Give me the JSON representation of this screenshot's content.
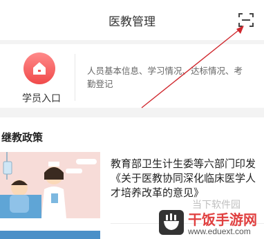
{
  "header": {
    "title": "医教管理",
    "scan_icon": "scan-icon"
  },
  "entry": {
    "label": "学员入口",
    "icon": "house-icon",
    "icon_color": "#f05252",
    "description": "人员基本信息、学习情况、达标情况、考勤登记"
  },
  "section": {
    "title": "继教政策"
  },
  "news": [
    {
      "title": "教育部卫生计生委等六部门印发《关于医教协同深化临床医学人才培养改革的意见》"
    }
  ],
  "watermark": {
    "line1": "当下软件园",
    "brand": "干饭手游网",
    "url": "www.eduext.com",
    "arrow_color": "#d0282e",
    "brand_color": "#e04040"
  }
}
